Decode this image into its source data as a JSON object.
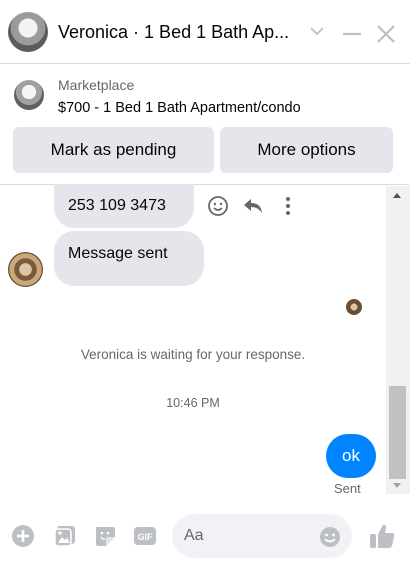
{
  "header": {
    "title": "Veronica · 1 Bed 1 Bath Ap...",
    "chevron_icon": "chevron-down-icon",
    "minimize_icon": "minimize-icon",
    "close_icon": "close-icon"
  },
  "listing": {
    "source": "Marketplace",
    "title": "$700 - 1 Bed 1 Bath Apartment/condo",
    "buttons": {
      "pending": "Mark as pending",
      "more": "More options"
    }
  },
  "messages": [
    {
      "from": "them",
      "text": "253 109 3473"
    },
    {
      "from": "them",
      "text": "Message sent"
    }
  ],
  "message_actions": [
    "react-icon",
    "reply-icon",
    "more-icon"
  ],
  "status": {
    "waiting": "Veronica is waiting for your response.",
    "timestamp": "10:46 PM"
  },
  "outgoing": {
    "text": "ok",
    "status": "Sent"
  },
  "composer": {
    "placeholder": "Aa",
    "icons": [
      "plus-icon",
      "photo-icon",
      "sticker-icon",
      "gif-icon",
      "emoji-icon",
      "like-icon"
    ],
    "gif_label": "GIF"
  },
  "colors": {
    "accent": "#0084ff",
    "bubble_in": "#e4e6eb",
    "icon_gray": "#bcc0c4",
    "secondary_text": "#65676b"
  }
}
